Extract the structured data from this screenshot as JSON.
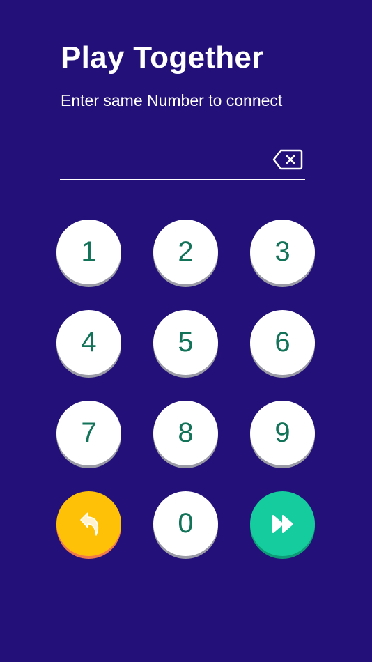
{
  "header": {
    "title": "Play Together",
    "subtitle": "Enter same Number to connect"
  },
  "input": {
    "value": "",
    "clear_icon": "backspace-icon"
  },
  "keypad": {
    "keys": [
      "1",
      "2",
      "3",
      "4",
      "5",
      "6",
      "7",
      "8",
      "9",
      "0"
    ],
    "back_icon": "undo-arrow-icon",
    "submit_icon": "fast-forward-icon"
  },
  "colors": {
    "background": "#231079",
    "key_face": "#ffffff",
    "key_digit": "#137358",
    "back_button": "#ffc107",
    "submit_button": "#14cc9d"
  }
}
